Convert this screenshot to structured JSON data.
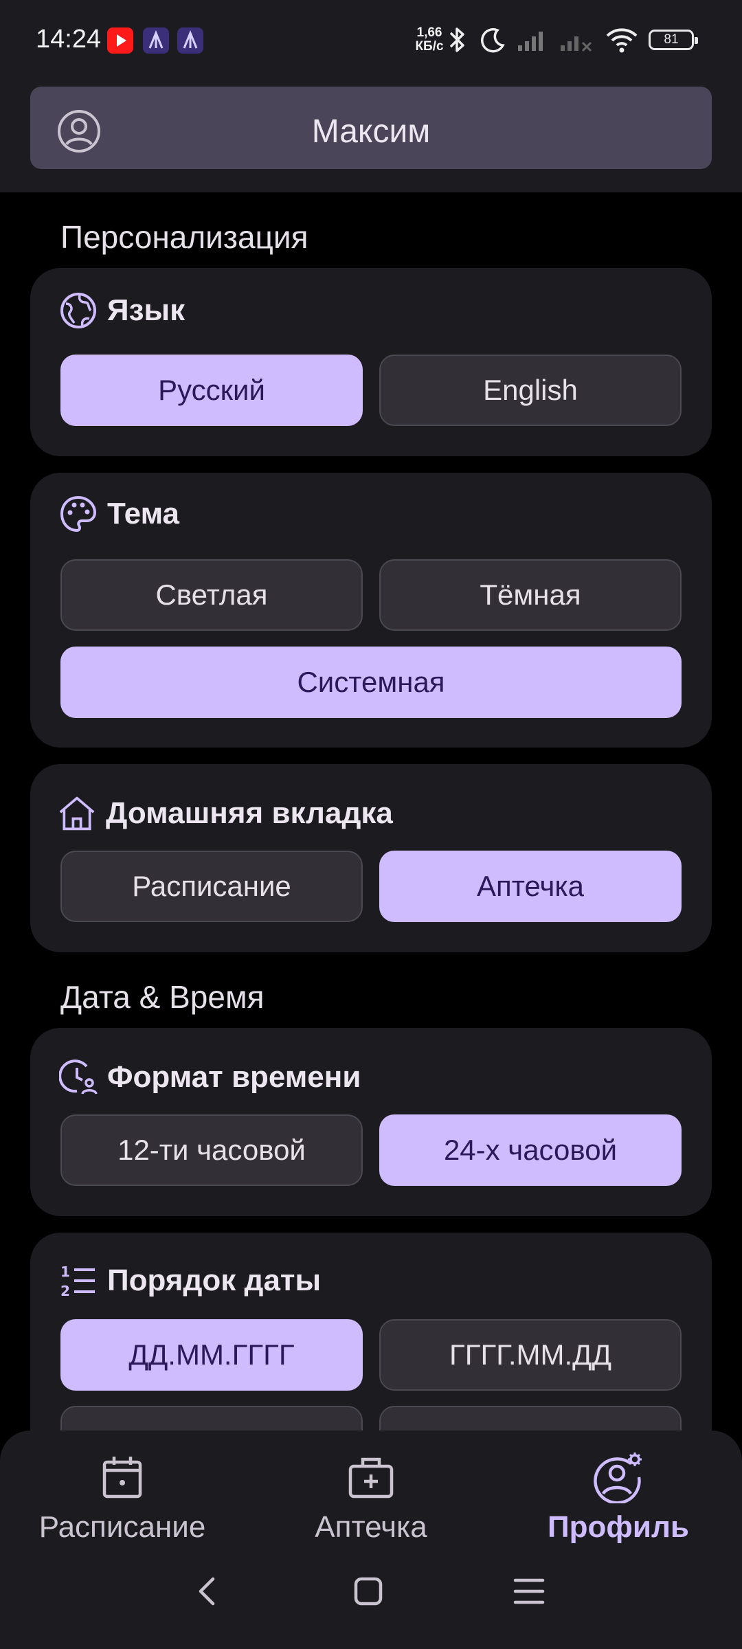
{
  "status_bar": {
    "time": "14:24",
    "net_speed_value": "1,66",
    "net_speed_unit": "КБ/с",
    "battery": "81",
    "icons": [
      "youtube-icon",
      "app-icon",
      "app-icon",
      "bluetooth-icon",
      "moon-icon",
      "signal-icon",
      "signal-off-icon",
      "wifi-icon",
      "battery-icon"
    ]
  },
  "header": {
    "user_name": "Максим",
    "icon": "account-circle-icon"
  },
  "sections": {
    "personalization": "Персонализация",
    "date_time": "Дата & Время"
  },
  "language": {
    "title": "Язык",
    "icon": "globe-icon",
    "options": [
      "Русский",
      "English"
    ],
    "selected": "Русский"
  },
  "theme": {
    "title": "Тема",
    "icon": "palette-icon",
    "options": [
      "Светлая",
      "Тёмная",
      "Системная"
    ],
    "selected": "Системная"
  },
  "home_tab": {
    "title": "Домашняя вкладка",
    "icon": "home-icon",
    "options": [
      "Расписание",
      "Аптечка"
    ],
    "selected": "Аптечка"
  },
  "time_format": {
    "title": "Формат времени",
    "icon": "clock-user-icon",
    "options": [
      "12-ти часовой",
      "24-х часовой"
    ],
    "selected": "24-х часовой"
  },
  "date_order": {
    "title": "Порядок даты",
    "icon": "ordered-list-icon",
    "options": [
      "ДД.ММ.ГГГГ",
      "ГГГГ.ММ.ДД"
    ],
    "selected": "ДД.ММ.ГГГГ"
  },
  "bottom_nav": {
    "items": [
      {
        "label": "Расписание",
        "icon": "calendar-icon"
      },
      {
        "label": "Аптечка",
        "icon": "medkit-icon"
      },
      {
        "label": "Профиль",
        "icon": "profile-settings-icon"
      }
    ],
    "active": "Профиль"
  },
  "colors": {
    "accent": "#cfbcff",
    "accent_text": "#2b1a59",
    "card": "#1c1b1f",
    "button_off": "#323036",
    "background": "#000000"
  }
}
